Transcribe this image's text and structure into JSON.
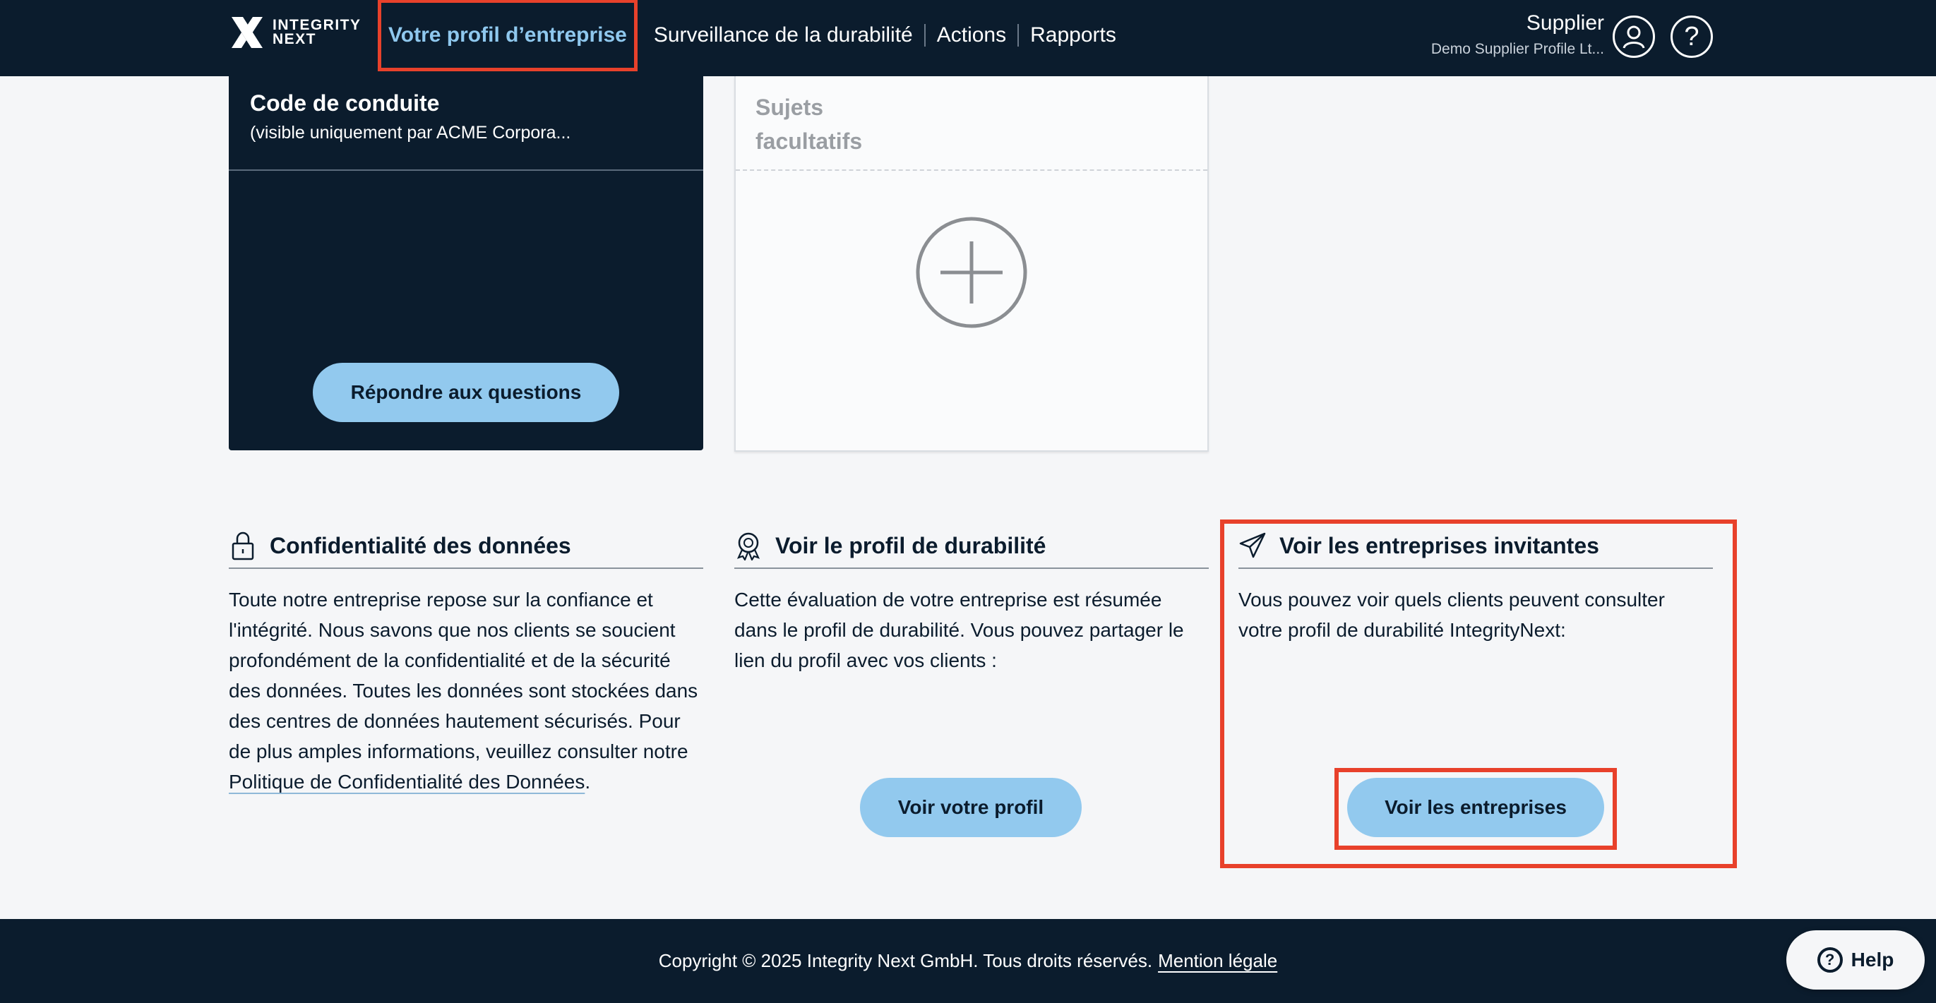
{
  "header": {
    "logo_line1": "INTEGRITY",
    "logo_line2": "NEXT",
    "nav": [
      {
        "label": "Votre profil d’entreprise",
        "active": true
      },
      {
        "label": "Surveillance de la durabilité"
      },
      {
        "label": "Actions"
      },
      {
        "label": "Rapports"
      }
    ],
    "user_name": "Supplier",
    "user_company": "Demo Supplier Profile Lt...",
    "help_icon_glyph": "?"
  },
  "cards": {
    "code_of_conduct": {
      "title": "Code de conduite",
      "subtitle": "(visible uniquement par ACME Corpora...",
      "button": "Répondre aux questions"
    },
    "optional_topics": {
      "title": "Sujets facultatifs",
      "icon": "plus-circle-icon"
    }
  },
  "sections": {
    "privacy": {
      "icon": "lock-icon",
      "title": "Confidentialité des données",
      "body": "Toute notre entreprise repose sur la confiance et l'intégrité. Nous savons que nos clients se soucient profondément de la confidentialité et de la sécurité des données. Toutes les données sont stockées dans des centres de données hautement sécurisés. Pour de plus amples informations, veuillez consulter notre ",
      "link": "Politique de Confidentialité des Données",
      "after_link": "."
    },
    "profile": {
      "icon": "award-badge-icon",
      "title": "Voir le profil de durabilité",
      "body": "Cette évaluation de votre entreprise est résumée dans le profil de durabilité. Vous pouvez partager le lien du profil avec vos clients :",
      "button": "Voir votre profil"
    },
    "inviting": {
      "icon": "paper-plane-icon",
      "title": "Voir les entreprises invitantes",
      "body": "Vous pouvez voir quels clients peuvent consulter votre profil de durabilité IntegrityNext:",
      "button": "Voir les entreprises"
    }
  },
  "footer": {
    "copyright": "Copyright © 2025 Integrity Next GmbH. Tous droits réservés.",
    "legal": "Mention légale"
  },
  "help": {
    "label": "Help",
    "glyph": "?"
  },
  "colors": {
    "navy": "#0b1c2d",
    "accent_blue": "#92c9ee",
    "highlight_red": "#e8412b"
  }
}
